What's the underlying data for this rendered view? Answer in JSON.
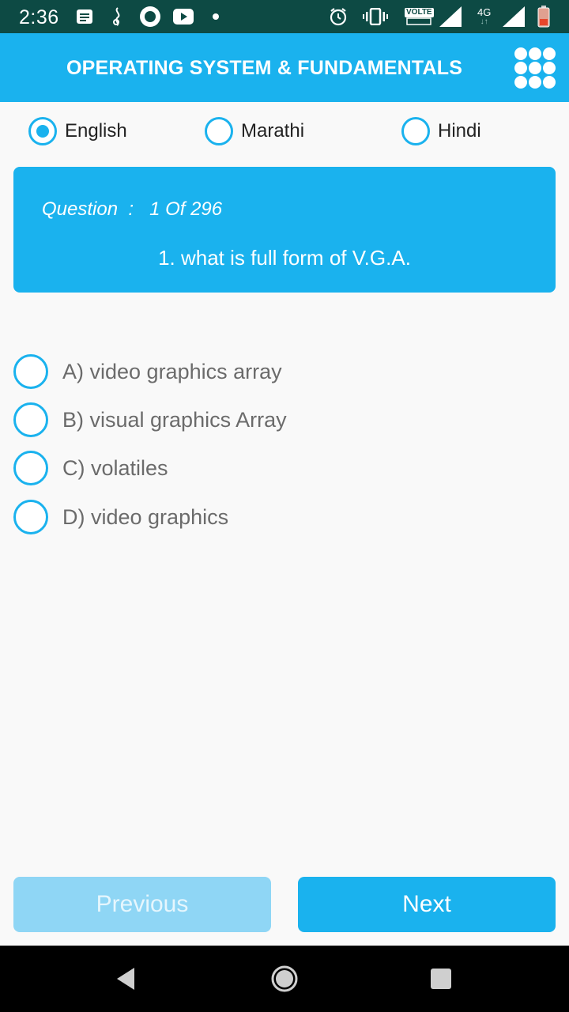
{
  "status_bar": {
    "time": "2:36",
    "volte_label": "VOLTE",
    "network_label": "4G"
  },
  "app_bar": {
    "title": "OPERATING SYSTEM & FUNDAMENTALS",
    "menu_icon": "grid-dots-icon"
  },
  "languages": [
    {
      "label": "English",
      "selected": true
    },
    {
      "label": "Marathi",
      "selected": false
    },
    {
      "label": "Hindi",
      "selected": false
    }
  ],
  "question": {
    "counter_prefix": "Question  :   1 Of 296",
    "text": "1. what is full form of V.G.A."
  },
  "options": [
    {
      "label": "A) video graphics array",
      "selected": false
    },
    {
      "label": "B) visual graphics Array",
      "selected": false
    },
    {
      "label": "C) volatiles",
      "selected": false
    },
    {
      "label": "D) video graphics",
      "selected": false
    }
  ],
  "buttons": {
    "previous": "Previous",
    "next": "Next"
  },
  "colors": {
    "accent": "#1ab2ee",
    "status_bar": "#0d4a44",
    "disabled_button": "#8fd6f5"
  }
}
